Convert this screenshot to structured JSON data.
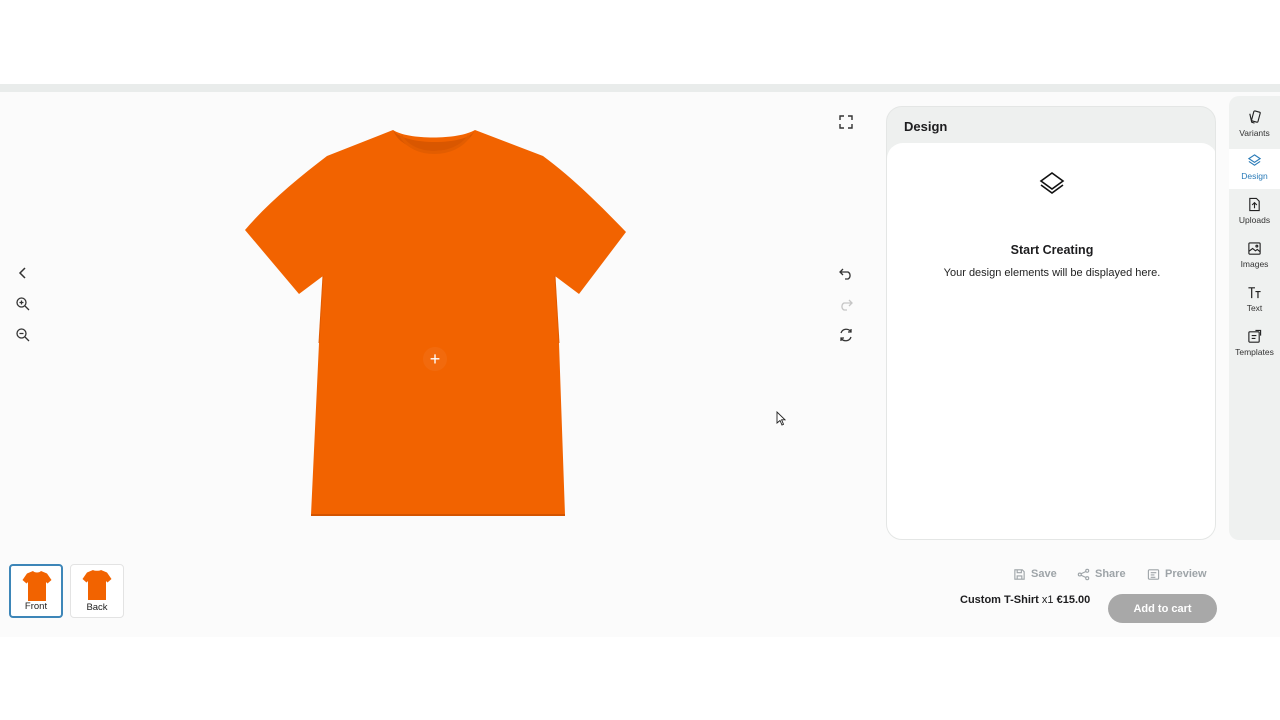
{
  "canvas": {
    "tools_left": [
      {
        "icon": "chevron-left-icon"
      },
      {
        "icon": "zoom-in-icon"
      },
      {
        "icon": "zoom-out-icon"
      }
    ],
    "tools_right": [
      {
        "icon": "fullscreen-icon"
      },
      {
        "icon": "undo-icon"
      },
      {
        "icon": "redo-icon"
      },
      {
        "icon": "reset-icon"
      }
    ],
    "product_color": "#f26300",
    "add_element_glyph": "+"
  },
  "design_panel": {
    "title": "Design",
    "empty_icon": "layers-icon",
    "empty_title": "Start Creating",
    "empty_subtitle": "Your design elements will be displayed here."
  },
  "side_rail": {
    "items": [
      {
        "label": "Variants",
        "icon": "variants-icon",
        "active": false
      },
      {
        "label": "Design",
        "icon": "layers-icon",
        "active": true
      },
      {
        "label": "Uploads",
        "icon": "upload-file-icon",
        "active": false
      },
      {
        "label": "Images",
        "icon": "image-icon",
        "active": false
      },
      {
        "label": "Text",
        "icon": "text-icon",
        "active": false
      },
      {
        "label": "Templates",
        "icon": "templates-icon",
        "active": false
      }
    ]
  },
  "actions": {
    "save": "Save",
    "share": "Share",
    "preview": "Preview"
  },
  "summary": {
    "product": "Custom T-Shirt",
    "quantity": "x1",
    "price": "€15.00",
    "add_to_cart": "Add to cart"
  },
  "views": [
    {
      "label": "Front",
      "active": true
    },
    {
      "label": "Back",
      "active": false
    }
  ],
  "colors": {
    "accent": "#2a7bb8",
    "disabled_button": "#a8a8a8"
  }
}
